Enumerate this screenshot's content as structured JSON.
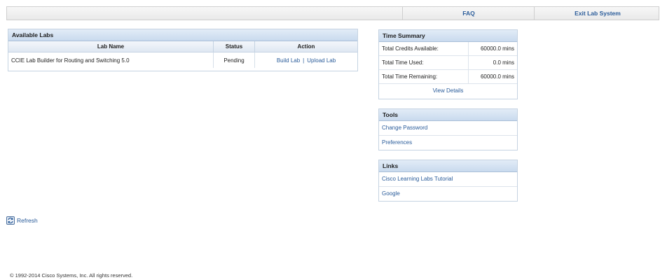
{
  "topnav": {
    "faq": "FAQ",
    "exit": "Exit Lab System"
  },
  "labs": {
    "title": "Available Labs",
    "columns": [
      "Lab Name",
      "Status",
      "Action"
    ],
    "rows": [
      {
        "name": "CCIE Lab Builder for Routing and Switching 5.0",
        "status": "Pending",
        "build": "Build Lab",
        "sep": "|",
        "upload": "Upload Lab"
      }
    ]
  },
  "time_summary": {
    "title": "Time Summary",
    "rows": [
      {
        "label": "Total Credits Available:",
        "value": "60000.0 mins"
      },
      {
        "label": "Total Time Used:",
        "value": "0.0 mins"
      },
      {
        "label": "Total Time Remaining:",
        "value": "60000.0 mins"
      }
    ],
    "view_details": "View Details"
  },
  "tools": {
    "title": "Tools",
    "items": [
      "Change Password",
      "Preferences"
    ]
  },
  "links": {
    "title": "Links",
    "items": [
      "Cisco Learning Labs Tutorial",
      "Google"
    ]
  },
  "refresh": {
    "label": "Refresh",
    "icon": "refresh-icon"
  },
  "footer": {
    "copyright": "© 1992-2014 Cisco Systems, Inc. All rights reserved."
  },
  "colors": {
    "link": "#2a5c9a",
    "header_bg": "#c9daee",
    "border": "#c5d3e2"
  }
}
